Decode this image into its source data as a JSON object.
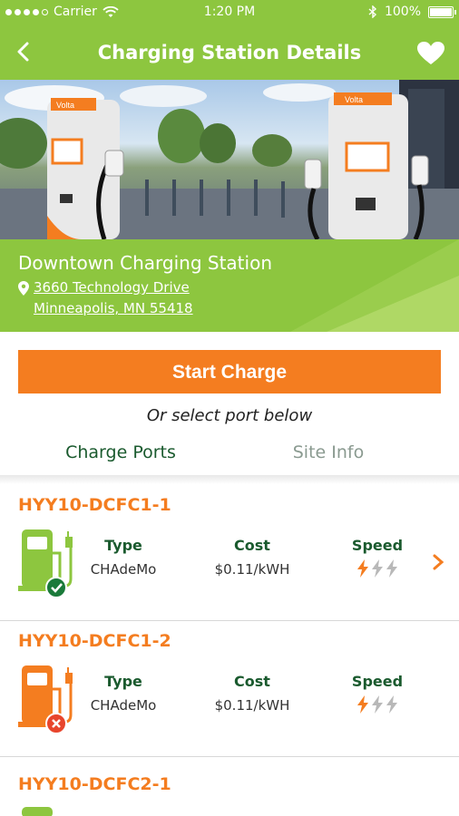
{
  "status_bar": {
    "carrier": "Carrier",
    "time": "1:20 PM",
    "battery": "100%"
  },
  "header": {
    "title": "Charging Station Details"
  },
  "station": {
    "name": "Downtown Charging Station",
    "address_line1": "3660 Technology Drive",
    "address_line2": "Minneapolis, MN 55418",
    "charger_brand_label": "Volta"
  },
  "actions": {
    "start_label": "Start Charge",
    "or_select": "Or select port below"
  },
  "tabs": [
    {
      "label": "Charge Ports"
    },
    {
      "label": "Site Info"
    }
  ],
  "ports": [
    {
      "id": "HYY10-DCFC1-1",
      "type_label": "Type",
      "type": "CHAdeMo",
      "cost_label": "Cost",
      "cost": "$0.11/kWH",
      "speed_label": "Speed",
      "speed_level": 1,
      "speed_max": 3,
      "status": "available"
    },
    {
      "id": "HYY10-DCFC1-2",
      "type_label": "Type",
      "type": "CHAdeMo",
      "cost_label": "Cost",
      "cost": "$0.11/kWH",
      "speed_label": "Speed",
      "speed_level": 1,
      "speed_max": 3,
      "status": "unavailable"
    },
    {
      "id": "HYY10-DCFC2-1",
      "status": "available"
    }
  ],
  "colors": {
    "brand_green": "#8dc63f",
    "accent_orange": "#f47d20",
    "dark_green": "#1a5a2e",
    "unavailable_red": "#e8452c"
  },
  "icons": [
    "back-chevron-icon",
    "heart-icon",
    "location-pin-icon",
    "charger-available-icon",
    "charger-unavailable-icon",
    "bolt-icon",
    "chevron-right-icon"
  ]
}
